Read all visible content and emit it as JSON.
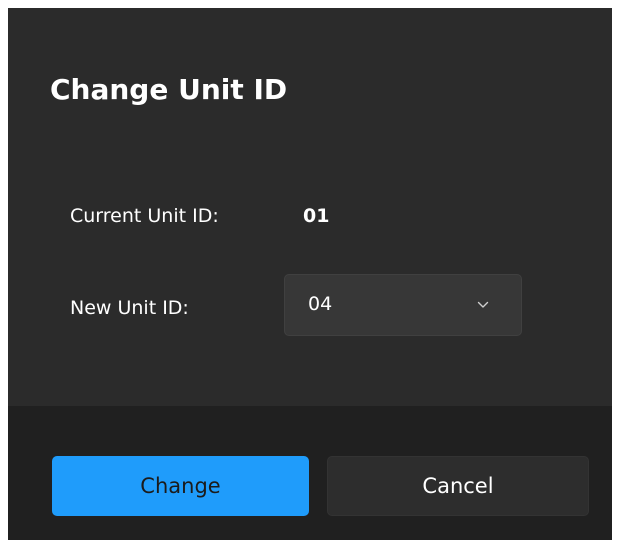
{
  "dialog": {
    "title": "Change Unit ID"
  },
  "form": {
    "current_label": "Current Unit ID:",
    "current_value": "01",
    "new_label": "New Unit ID:",
    "new_value": "04"
  },
  "buttons": {
    "change_label": "Change",
    "cancel_label": "Cancel"
  },
  "icons": {
    "dropdown": "chevron-down-icon"
  },
  "colors": {
    "dialog_background": "#2b2b2b",
    "footer_background": "#202020",
    "primary_button": "#1f9cfb",
    "dropdown_background": "#373737"
  }
}
